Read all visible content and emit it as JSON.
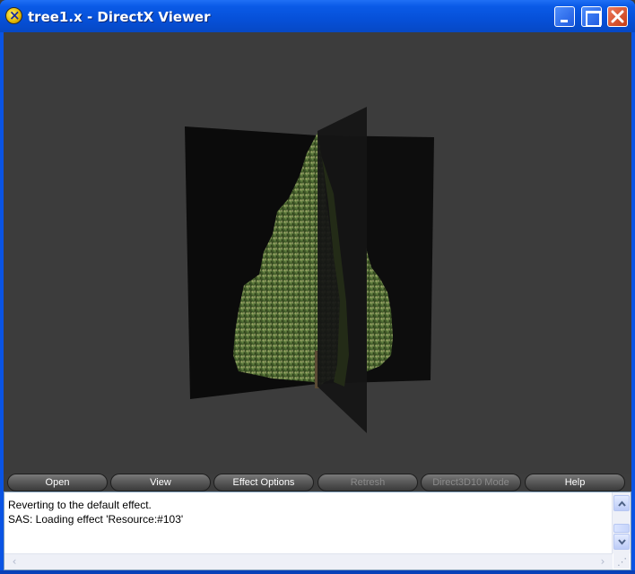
{
  "window": {
    "title": "tree1.x - DirectX Viewer",
    "app_icon": "directx-x-icon"
  },
  "caption_buttons": {
    "minimize": "minimize-icon",
    "maximize": "maximize-icon",
    "close": "close-icon"
  },
  "toolbar": {
    "buttons": [
      {
        "label": "Open",
        "enabled": true
      },
      {
        "label": "View",
        "enabled": true
      },
      {
        "label": "Effect Options",
        "enabled": true
      },
      {
        "label": "Retresh",
        "enabled": false
      },
      {
        "label": "Direct3D10 Mode",
        "enabled": false
      },
      {
        "label": "Help",
        "enabled": true
      }
    ]
  },
  "log": {
    "lines": [
      "Reverting to the default effect.",
      "SAS: Loading effect 'Resource:#103'"
    ]
  },
  "scrollbars": {
    "up_arrow": "chevron-up-icon",
    "down_arrow": "chevron-down-icon",
    "left_arrow": "chevron-left-icon",
    "right_arrow": "chevron-right-icon"
  },
  "colors": {
    "titlebar": "#0a54e4",
    "viewport_background": "#3c3c3c",
    "foliage": "#5f7a3c"
  }
}
